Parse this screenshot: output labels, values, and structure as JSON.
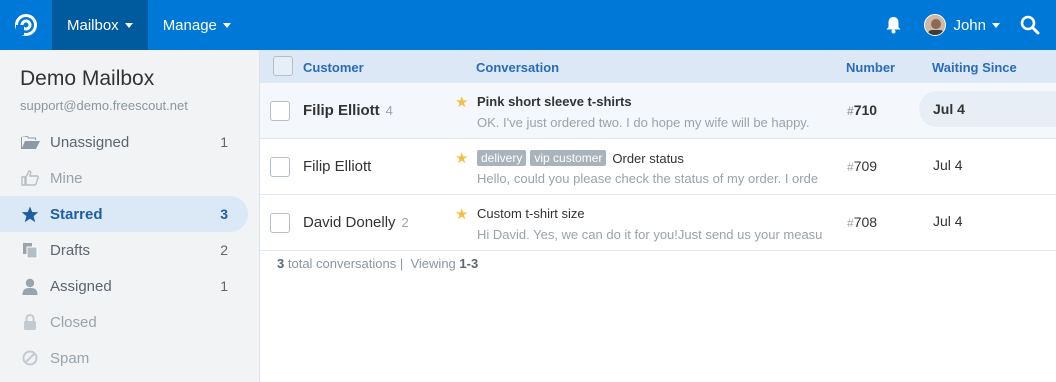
{
  "nav": {
    "mailbox": "Mailbox",
    "manage": "Manage",
    "user": "John"
  },
  "sidebar": {
    "title": "Demo Mailbox",
    "email": "support@demo.freescout.net",
    "folders": [
      {
        "label": "Unassigned",
        "count": "1",
        "icon": "folder-open-icon"
      },
      {
        "label": "Mine",
        "count": "",
        "icon": "thumbs-up-icon"
      },
      {
        "label": "Starred",
        "count": "3",
        "icon": "star-icon"
      },
      {
        "label": "Drafts",
        "count": "2",
        "icon": "drafts-icon"
      },
      {
        "label": "Assigned",
        "count": "1",
        "icon": "user-icon"
      },
      {
        "label": "Closed",
        "count": "",
        "icon": "lock-icon"
      },
      {
        "label": "Spam",
        "count": "",
        "icon": "ban-icon"
      }
    ]
  },
  "table": {
    "headers": {
      "customer": "Customer",
      "conversation": "Conversation",
      "number": "Number",
      "waiting": "Waiting Since"
    },
    "rows": [
      {
        "customer": "Filip Elliott",
        "customer_count": "4",
        "tags": [],
        "subject": "Pink short sleeve t-shirts",
        "preview": "OK. I've just ordered two. I do hope my wife will be happy.",
        "hash": "#",
        "number": "710",
        "waiting": "Jul 4"
      },
      {
        "customer": "Filip Elliott",
        "customer_count": "",
        "tags": [
          "delivery",
          "vip customer"
        ],
        "subject": "Order status",
        "preview": "Hello, could you please check the status of my order. I orde",
        "hash": "#",
        "number": "709",
        "waiting": "Jul 4"
      },
      {
        "customer": "David Donelly",
        "customer_count": "2",
        "tags": [],
        "subject": "Custom t-shirt size",
        "preview": "Hi David. Yes, we can do it for you!Just send us your measu",
        "hash": "#",
        "number": "708",
        "waiting": "Jul 4"
      }
    ]
  },
  "footer": {
    "total": "3",
    "total_label": "total conversations |",
    "viewing_label": "Viewing",
    "range": "1-3"
  },
  "colors": {
    "brand": "#0078d7",
    "nav_active": "#005a9e",
    "star": "#f2c044",
    "active_folder": "#dbe9f7"
  }
}
